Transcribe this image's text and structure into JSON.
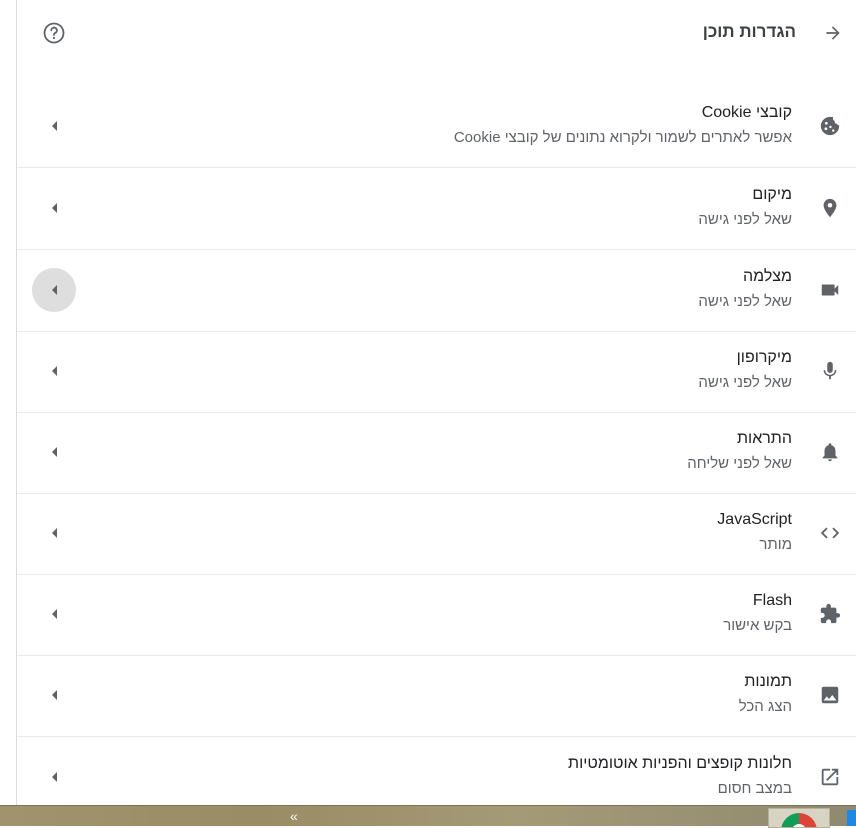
{
  "header": {
    "title": "הגדרות תוכן",
    "back_icon": "arrow-right-icon",
    "help_icon": "help-circle-icon"
  },
  "rows": [
    {
      "title": "קובצי Cookie",
      "subtitle": "אפשר לאתרים לשמור ולקרוא נתונים של קובצי Cookie",
      "icon": "cookie-icon"
    },
    {
      "title": "מיקום",
      "subtitle": "שאל לפני גישה",
      "icon": "location-pin-icon"
    },
    {
      "title": "מצלמה",
      "subtitle": "שאל לפני גישה",
      "icon": "videocam-icon"
    },
    {
      "title": "מיקרופון",
      "subtitle": "שאל לפני גישה",
      "icon": "mic-icon"
    },
    {
      "title": "התראות",
      "subtitle": "שאל לפני שליחה",
      "icon": "bell-icon"
    },
    {
      "title": "JavaScript",
      "subtitle": "מותר",
      "icon": "code-icon"
    },
    {
      "title": "Flash",
      "subtitle": "בקש אישור",
      "icon": "puzzle-icon"
    },
    {
      "title": "תמונות",
      "subtitle": "הצג הכל",
      "icon": "image-icon"
    },
    {
      "title": "חלונות קופצים והפניות אוטומטיות",
      "subtitle": "במצב חסום",
      "icon": "open-in-new-icon"
    }
  ],
  "taskbar": {
    "chevron": "«"
  },
  "colors": {
    "icon": "#5f6368",
    "title": "#202124",
    "subtitle": "#5f6368",
    "divider": "#e8eaed",
    "hover": "#dedede"
  }
}
